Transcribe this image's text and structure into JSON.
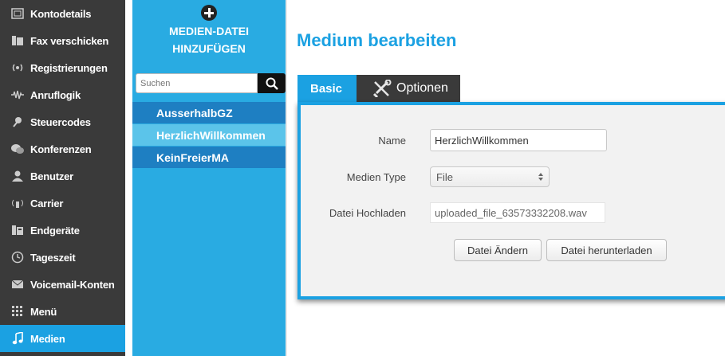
{
  "nav": {
    "items": [
      {
        "label": "Kontodetails",
        "icon": "window-icon"
      },
      {
        "label": "Fax verschicken",
        "icon": "fax-icon"
      },
      {
        "label": "Registrierungen",
        "icon": "signal-icon"
      },
      {
        "label": "Anruflogik",
        "icon": "waveform-icon"
      },
      {
        "label": "Steuercodes",
        "icon": "pin-icon"
      },
      {
        "label": "Konferenzen",
        "icon": "chat-icon"
      },
      {
        "label": "Benutzer",
        "icon": "user-icon"
      },
      {
        "label": "Carrier",
        "icon": "antenna-icon"
      },
      {
        "label": "Endgeräte",
        "icon": "phone-icon"
      },
      {
        "label": "Tageszeit",
        "icon": "clock-icon"
      },
      {
        "label": "Voicemail-Konten",
        "icon": "mail-icon"
      },
      {
        "label": "Menü",
        "icon": "grid-icon"
      },
      {
        "label": "Medien",
        "icon": "music-note-icon",
        "active": true
      }
    ]
  },
  "media_panel": {
    "add_label_line1": "MEDIEN-DATEI",
    "add_label_line2": "HINZUFÜGEN",
    "search_placeholder": "Suchen",
    "items": [
      {
        "label": "AusserhalbGZ",
        "selected": false
      },
      {
        "label": "HerzlichWillkommen",
        "selected": true
      },
      {
        "label": "KeinFreierMA",
        "selected": false
      }
    ]
  },
  "main": {
    "title": "Medium bearbeiten",
    "tabs": {
      "basic": "Basic",
      "options": "Optionen"
    },
    "form": {
      "name_label": "Name",
      "name_value": "HerzlichWillkommen",
      "type_label": "Medien Type",
      "type_value": "File",
      "upload_label": "Datei Hochladen",
      "upload_value": "uploaded_file_63573332208.wav",
      "change_button": "Datei Ändern",
      "download_button": "Datei herunterladen"
    }
  },
  "colors": {
    "accent": "#1ba1e2",
    "nav_bg": "#3a3a3a",
    "panel_bg": "#29abe2"
  }
}
